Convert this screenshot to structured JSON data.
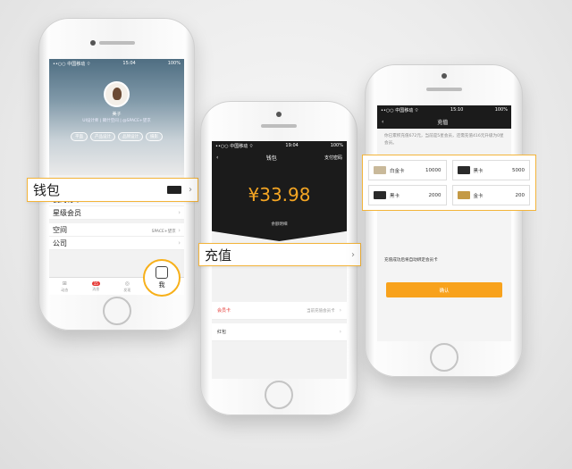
{
  "colors": {
    "accent": "#f8a21c",
    "balance": "#f5a623",
    "dark": "#1b1b1b",
    "callout_border": "#f3b43a"
  },
  "phone1": {
    "status": {
      "carrier": "••○○ 中国移动 ⌔",
      "time": "15:04",
      "battery": "100%"
    },
    "profile": {
      "name": "美子",
      "job": "UI设计师 | 碉什空间 | @SPACE+望京"
    },
    "tags": [
      "平面",
      "产品设计",
      "品牌设计",
      "摄影"
    ],
    "menu": {
      "orders": "我的订单",
      "vip": "星级会员",
      "space": "空间",
      "space_value": "SPACE+望京",
      "company": "公司"
    },
    "tabs": [
      {
        "icon": "grid-icon",
        "label": "动态"
      },
      {
        "icon": "message-icon",
        "label": "消息",
        "badge": "15"
      },
      {
        "icon": "compass-icon",
        "label": "发现"
      }
    ],
    "me_label": "我"
  },
  "wallet_callout": {
    "label": "钱包"
  },
  "phone2": {
    "status": {
      "carrier": "••○○ 中国移动 ⌔",
      "time": "19:04",
      "battery": "100%"
    },
    "nav": {
      "back": "‹",
      "title": "钱包",
      "right": "支付密码"
    },
    "balance": "¥33.98",
    "balance_label": "余额明细",
    "rows": [
      {
        "label": "会员卡",
        "sub": "当前充值会员卡"
      },
      {
        "label": "红包",
        "sub": ""
      }
    ]
  },
  "charge_callout": {
    "label": "充值"
  },
  "phone3": {
    "status": {
      "carrier": "••○○ 中国移动 ⌔",
      "time": "15:10",
      "battery": "100%"
    },
    "nav": {
      "back": "‹",
      "title": "充值"
    },
    "desc": "你已累积充值672元，当前是5星会员，还需充值416元升级为0星会员。",
    "cards": [
      {
        "name": "白金卡",
        "amount": "10000",
        "color": "#c9b99a"
      },
      {
        "name": "黑卡",
        "amount": "5000",
        "color": "#2a2a2a"
      },
      {
        "name": "黑卡",
        "amount": "2000",
        "color": "#2a2a2a"
      },
      {
        "name": "金卡",
        "amount": "200",
        "color": "#c49a45"
      }
    ],
    "note": "充值成功后将自动绑定会员卡",
    "confirm": "确认"
  }
}
